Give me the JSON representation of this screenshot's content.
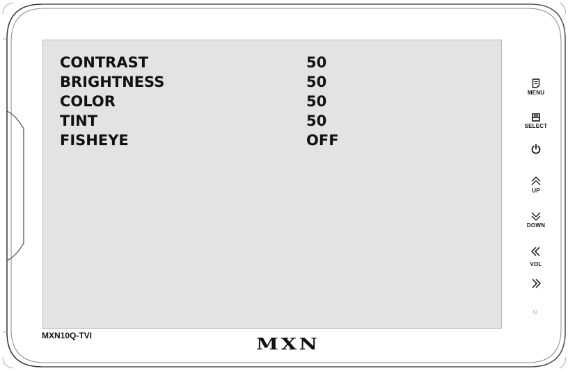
{
  "osd": {
    "rows": [
      {
        "label": "CONTRAST",
        "value": "50"
      },
      {
        "label": "BRIGHTNESS",
        "value": "50"
      },
      {
        "label": "COLOR",
        "value": "50"
      },
      {
        "label": "TINT",
        "value": "50"
      },
      {
        "label": "FISHEYE",
        "value": "OFF"
      }
    ]
  },
  "device": {
    "model": "MXN10Q-TVI",
    "brand": "MXN"
  },
  "buttons": {
    "menu": {
      "label": "MENU",
      "icon": "menu-icon"
    },
    "select": {
      "label": "SELECT",
      "icon": "select-icon"
    },
    "power": {
      "icon": "power-icon"
    },
    "up": {
      "label": "UP",
      "icon": "chevron-up-icon"
    },
    "down": {
      "label": "DOWN",
      "icon": "chevron-down-icon"
    },
    "vol": {
      "label": "VOL",
      "down_icon": "double-chevron-left-icon",
      "up_icon": "double-chevron-right-icon"
    },
    "led": {
      "icon": "status-led-icon"
    }
  }
}
